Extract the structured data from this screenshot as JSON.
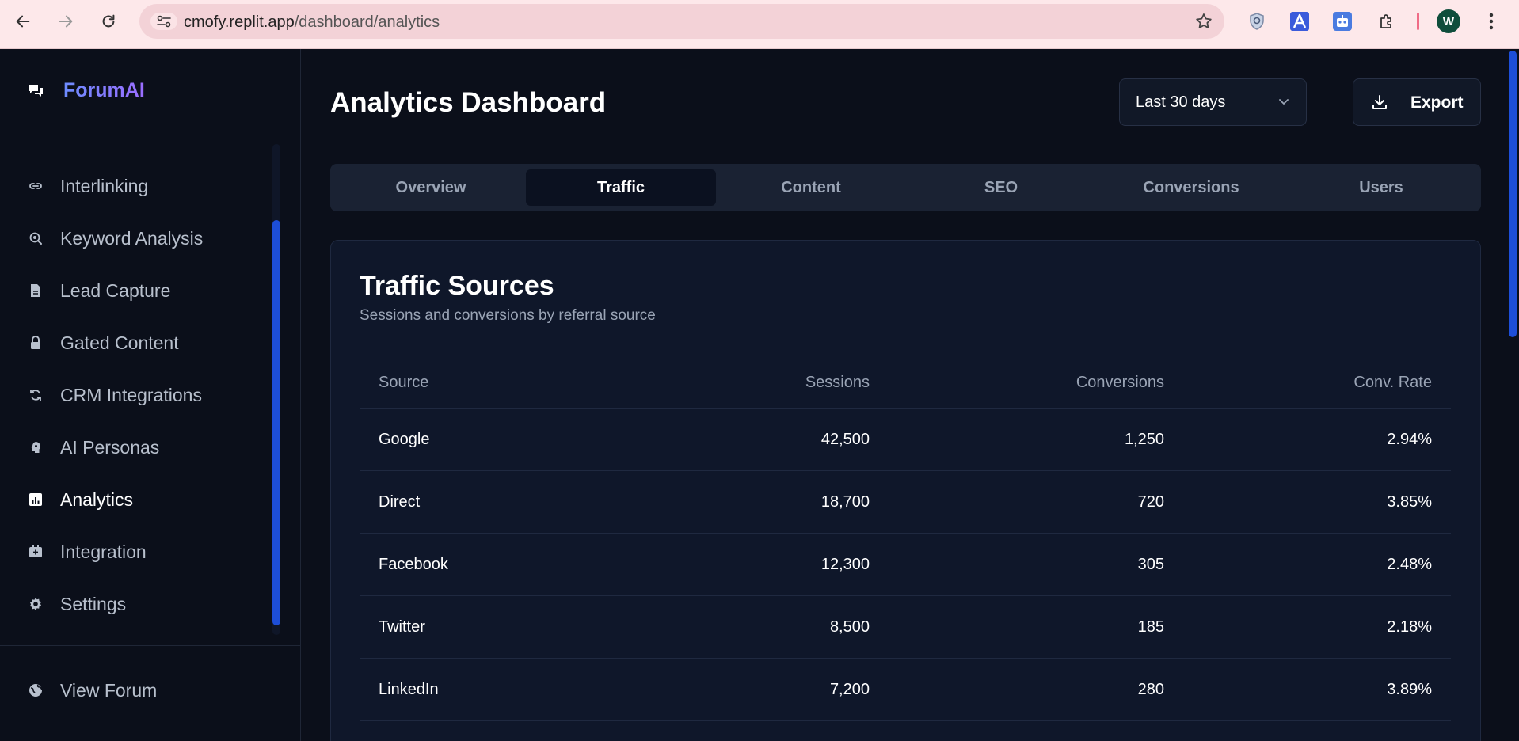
{
  "browser": {
    "url_host": "cmofy.replit.app",
    "url_path": "/dashboard/analytics",
    "profile_initial": "W"
  },
  "sidebar": {
    "brand": "ForumAI",
    "items": [
      {
        "label": "Interlinking",
        "icon": "link-icon"
      },
      {
        "label": "Keyword Analysis",
        "icon": "search-target-icon"
      },
      {
        "label": "Lead Capture",
        "icon": "document-icon"
      },
      {
        "label": "Gated Content",
        "icon": "lock-icon"
      },
      {
        "label": "CRM Integrations",
        "icon": "sync-icon"
      },
      {
        "label": "AI Personas",
        "icon": "head-icon"
      },
      {
        "label": "Analytics",
        "icon": "bar-chart-icon",
        "active": true
      },
      {
        "label": "Integration",
        "icon": "plug-icon"
      },
      {
        "label": "Settings",
        "icon": "gear-icon"
      }
    ],
    "footer_items": [
      {
        "label": "View Forum",
        "icon": "globe-icon"
      }
    ]
  },
  "header": {
    "title": "Analytics Dashboard",
    "range_value": "Last 30 days",
    "export_label": "Export"
  },
  "tabs": [
    {
      "label": "Overview"
    },
    {
      "label": "Traffic",
      "active": true
    },
    {
      "label": "Content"
    },
    {
      "label": "SEO"
    },
    {
      "label": "Conversions"
    },
    {
      "label": "Users"
    }
  ],
  "traffic": {
    "title": "Traffic Sources",
    "subtitle": "Sessions and conversions by referral source",
    "columns": [
      "Source",
      "Sessions",
      "Conversions",
      "Conv. Rate"
    ],
    "rows": [
      [
        "Google",
        "42,500",
        "1,250",
        "2.94%"
      ],
      [
        "Direct",
        "18,700",
        "720",
        "3.85%"
      ],
      [
        "Facebook",
        "12,300",
        "305",
        "2.48%"
      ],
      [
        "Twitter",
        "8,500",
        "185",
        "2.18%"
      ],
      [
        "LinkedIn",
        "7,200",
        "280",
        "3.89%"
      ]
    ]
  },
  "colors": {
    "accent": "#1d4ed8",
    "background": "#0b0f1a",
    "card": "#0f172a",
    "brand_gradient_start": "#6d8cff",
    "brand_gradient_end": "#9b6dff"
  }
}
